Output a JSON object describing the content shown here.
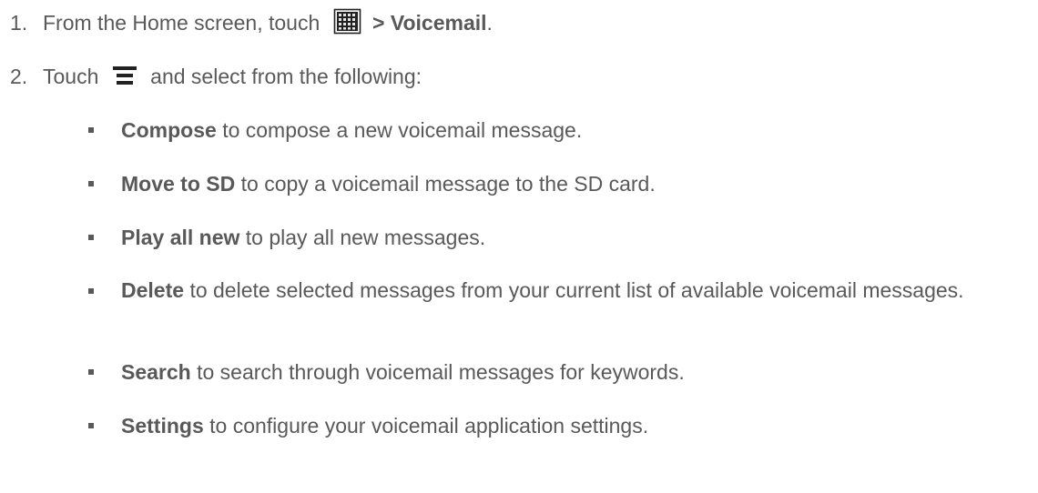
{
  "steps": [
    {
      "number": "1.",
      "text_before": "From the Home screen, touch",
      "icon": "apps-grid-icon",
      "text_bold": "> Voicemail",
      "text_after": "."
    },
    {
      "number": "2.",
      "text_before": "Touch",
      "icon": "menu-icon",
      "text_after": "and select from the following:"
    }
  ],
  "options": [
    {
      "term": "Compose",
      "desc": "to compose a new voicemail message."
    },
    {
      "term": "Move to SD",
      "desc": "to copy a voicemail message to the SD card."
    },
    {
      "term": "Play all new",
      "desc": "to play all new messages."
    },
    {
      "term": "Delete",
      "desc": "to delete selected messages from your current list of available voicemail messages."
    },
    {
      "term": "Search",
      "desc": "to search through voicemail messages for keywords."
    },
    {
      "term": "Settings",
      "desc": "to configure your voicemail application settings."
    }
  ],
  "colors": {
    "text": "#595959",
    "icon_dark": "#222222",
    "icon_light": "#e6e6e6"
  }
}
